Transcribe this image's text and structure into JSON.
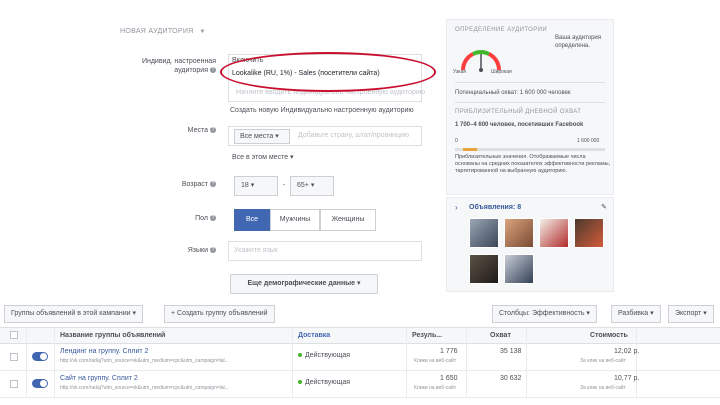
{
  "audience": {
    "header": "НОВАЯ АУДИТОРИЯ",
    "custom_label_line1": "Индивид. настроенная",
    "custom_label_line2": "аудитория",
    "include_label": "Включить",
    "lookalike_value": "Lookalike (RU, 1%) - Sales (посетители сайта)",
    "custom_placeholder": "Начните вводить индивидуально настроенную аудиторию",
    "create_link": "Создать новую Индивидуально настроенную аудиторию",
    "places_label": "Места",
    "places_dropdown": "Все места",
    "places_placeholder": "Добавьте страну, штат/провинцию",
    "places_all_link": "Все в этом месте",
    "age_label": "Возраст",
    "age_from": "18",
    "age_to": "65+",
    "gender_label": "Пол",
    "gender_options": [
      "Все",
      "Мужчины",
      "Женщины"
    ],
    "gender_selected": "Все",
    "language_label": "Языки",
    "language_placeholder": "Укажите язык",
    "more_demographics": "Еще демографические данные"
  },
  "right_panel": {
    "definition_title": "ОПРЕДЕЛЕНИЕ АУДИТОРИИ",
    "definition_text": "Ваша аудитория определена.",
    "gauge_left": "Узкая",
    "gauge_right": "Широкая",
    "potential_reach": "Потенциальный охват: 1 600 000 человек",
    "daily_reach_title": "ПРИБЛИЗИТЕЛЬНЫЙ ДНЕВНОЙ ОХВАТ",
    "daily_reach_value": "1 700–4 600 человек, посетивших Facebook",
    "bar_left": "0",
    "bar_right": "1 600 000",
    "disclaimer": "Приблизительные значения. Отображаемые числа основаны на средних показателях эффективности рекламы, таргетированной на выбранную аудиторию.",
    "ads_title": "Объявления: 8",
    "accent": "#e8a33d"
  },
  "toolbar": {
    "groups_btn": "Группы объявлений в этой кампании",
    "create_btn": "+ Создать группу объявлений",
    "columns_btn": "Столбцы: Эффективность",
    "breakdown_btn": "Разбивка",
    "export_btn": "Экспорт"
  },
  "table": {
    "headers": [
      "Название группы объявлений",
      "Доставка",
      "Резуль...",
      "Охват",
      "Стоимость"
    ],
    "rows": [
      {
        "name": "Лендинг на группу. Сплит 2",
        "url": "http://vk.com/radaj?utm_source=vk&utm_medium=cpc&utm_campaign=lal...",
        "status": "Действующая",
        "results": "1 776",
        "results_sub": "Клики на веб-сайт",
        "reach": "35 138",
        "cost": "12,02 р.",
        "cost_sub": "За клик на веб-сайт"
      },
      {
        "name": "Сайт на группу. Сплит 2",
        "url": "http://vk.com/radaj?utm_source=vk&utm_medium=cpc&utm_campaign=lal...",
        "status": "Действующая",
        "results": "1 650",
        "results_sub": "Клики на веб-сайт",
        "reach": "30 632",
        "cost": "10,77 р.",
        "cost_sub": "За клик на веб-сайт"
      }
    ]
  }
}
